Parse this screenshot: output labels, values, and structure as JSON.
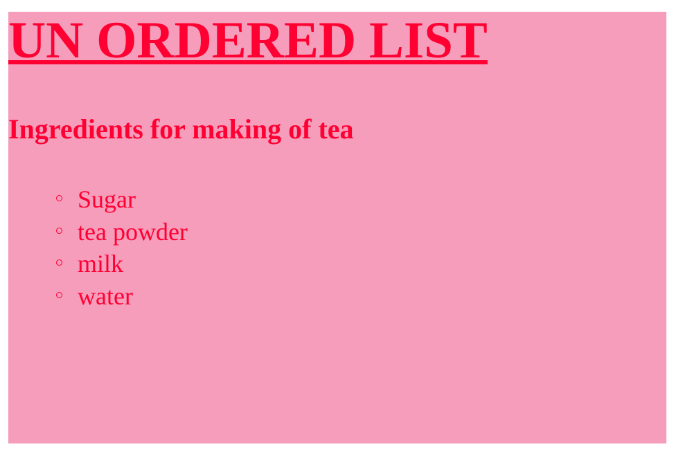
{
  "page": {
    "title": "UN ORDERED LIST",
    "subtitle": "Ingredients for making of tea",
    "ingredients": [
      "Sugar",
      "tea powder",
      "milk",
      "water"
    ]
  },
  "colors": {
    "background": "#f59dbb",
    "text": "#ff0033"
  }
}
